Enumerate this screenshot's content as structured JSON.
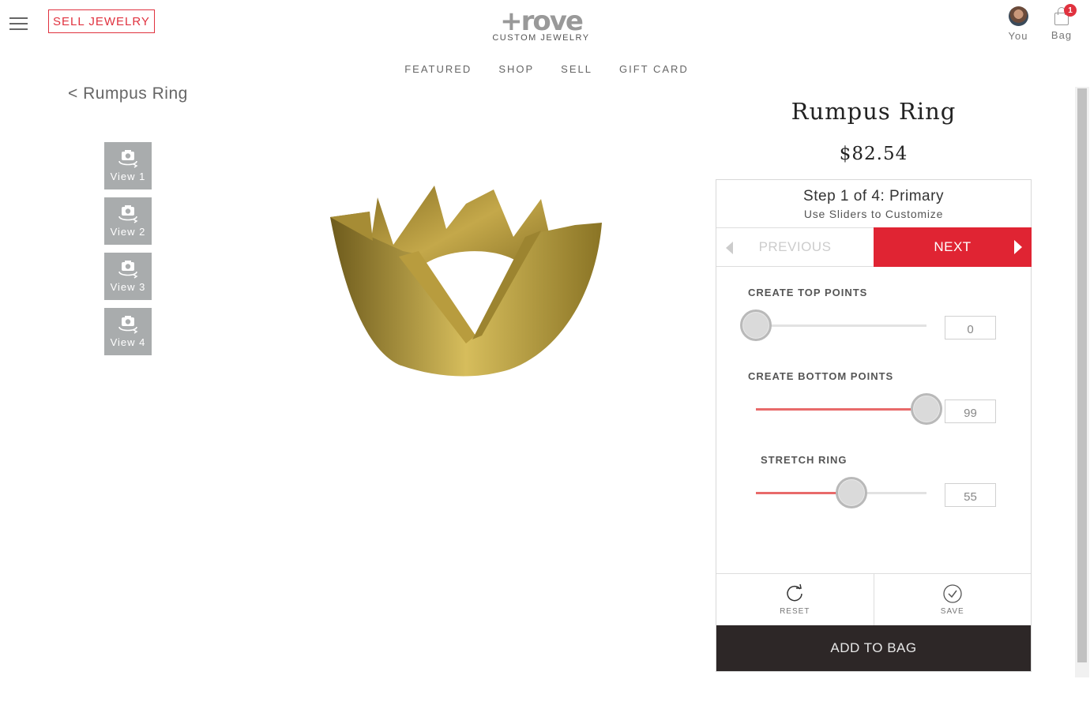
{
  "header": {
    "sell_label": "SELL JEWELRY",
    "logo_word": "+rove",
    "logo_sub": "CUSTOM JEWELRY",
    "user_label": "You",
    "bag_label": "Bag",
    "bag_count": "1"
  },
  "nav": {
    "items": [
      {
        "label": "FEATURED"
      },
      {
        "label": "SHOP"
      },
      {
        "label": "SELL"
      },
      {
        "label": "GIFT CARD"
      }
    ]
  },
  "breadcrumb": "< Rumpus Ring",
  "views": [
    {
      "label": "View 1"
    },
    {
      "label": "View 2"
    },
    {
      "label": "View 3"
    },
    {
      "label": "View 4"
    }
  ],
  "product": {
    "title": "Rumpus Ring",
    "price": "$82.54"
  },
  "step": {
    "title": "Step 1 of 4: Primary",
    "subtitle": "Use Sliders to Customize",
    "previous_label": "PREVIOUS",
    "next_label": "NEXT"
  },
  "sliders": [
    {
      "label": "CREATE TOP POINTS",
      "value": "0",
      "fraction": 0.0
    },
    {
      "label": "CREATE BOTTOM POINTS",
      "value": "99",
      "fraction": 1.0
    },
    {
      "label": "STRETCH RING",
      "value": "55",
      "fraction": 0.56
    }
  ],
  "actions": {
    "reset_label": "RESET",
    "save_label": "SAVE",
    "add_to_bag_label": "ADD TO BAG"
  },
  "colors": {
    "accent": "#e02433",
    "dark_button": "#2d2727",
    "gold": "#b59a3c"
  }
}
